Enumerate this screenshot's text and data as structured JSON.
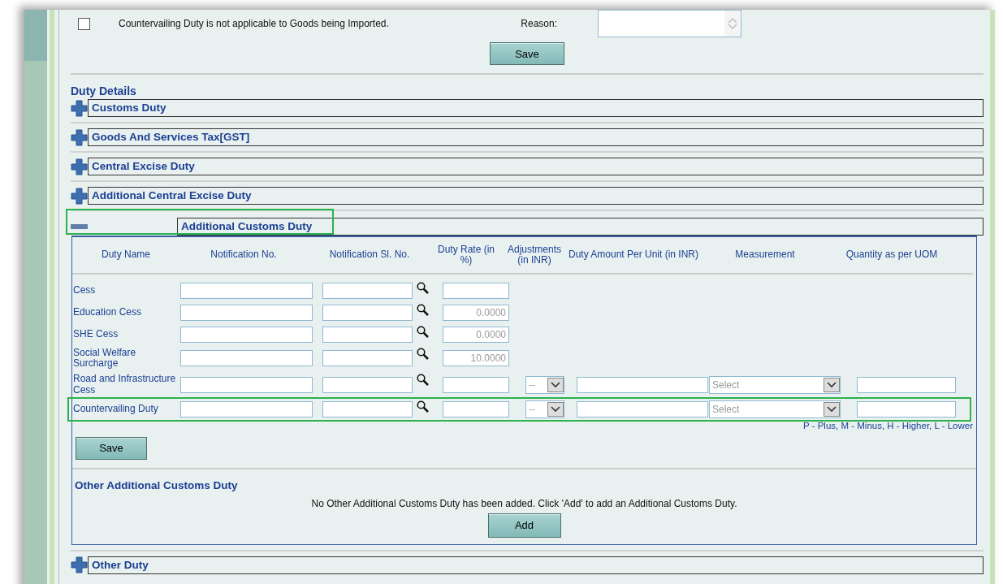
{
  "notice": {
    "checked": false,
    "label": "Countervailing Duty is not applicable to Goods being Imported.",
    "reason_label": "Reason:",
    "save_button": "Save"
  },
  "duty_details": {
    "title": "Duty Details",
    "sections": [
      {
        "title": "Customs Duty",
        "expanded": false,
        "highlighted": false
      },
      {
        "title": "Goods And Services Tax[GST]",
        "expanded": false,
        "highlighted": false
      },
      {
        "title": "Central Excise Duty",
        "expanded": false,
        "highlighted": false
      },
      {
        "title": "Additional Central Excise Duty",
        "expanded": false,
        "highlighted": false
      },
      {
        "title": "Additional Customs Duty",
        "expanded": true,
        "highlighted": true,
        "table": {
          "columns": [
            "Duty Name",
            "Notification No.",
            "Notification Sl. No.",
            "Duty Rate (in %)",
            "Adjustments (in INR)",
            "Duty Amount Per Unit (in INR)",
            "Measurement",
            "Quantity as per UOM"
          ],
          "rows": [
            {
              "name": "Cess",
              "rate": "",
              "rate_disabled": false,
              "highlighted": false
            },
            {
              "name": "Education Cess",
              "rate": "0.0000",
              "rate_disabled": true,
              "highlighted": false
            },
            {
              "name": "SHE Cess",
              "rate": "0.0000",
              "rate_disabled": true,
              "highlighted": false
            },
            {
              "name": "Social Welfare Surcharge",
              "rate": "10.0000",
              "rate_disabled": true,
              "highlighted": false
            },
            {
              "name": "Road and Infrastructure Cess",
              "rate": "",
              "rate_disabled": false,
              "adjustment": "--",
              "measurement_placeholder": "Select",
              "highlighted": false
            },
            {
              "name": "Countervailing Duty",
              "rate": "",
              "rate_disabled": false,
              "adjustment": "--",
              "measurement_placeholder": "Select",
              "highlighted": true
            }
          ]
        },
        "legend": "P - Plus, M - Minus, H - Higher, L - Lower",
        "save_button": "Save",
        "other_title": "Other Additional Customs Duty",
        "other_message": "No Other Additional Customs Duty has been added. Click 'Add' to add an Additional Customs Duty.",
        "add_button": "Add"
      },
      {
        "title": "Other Duty",
        "expanded": false,
        "highlighted": false
      }
    ]
  }
}
